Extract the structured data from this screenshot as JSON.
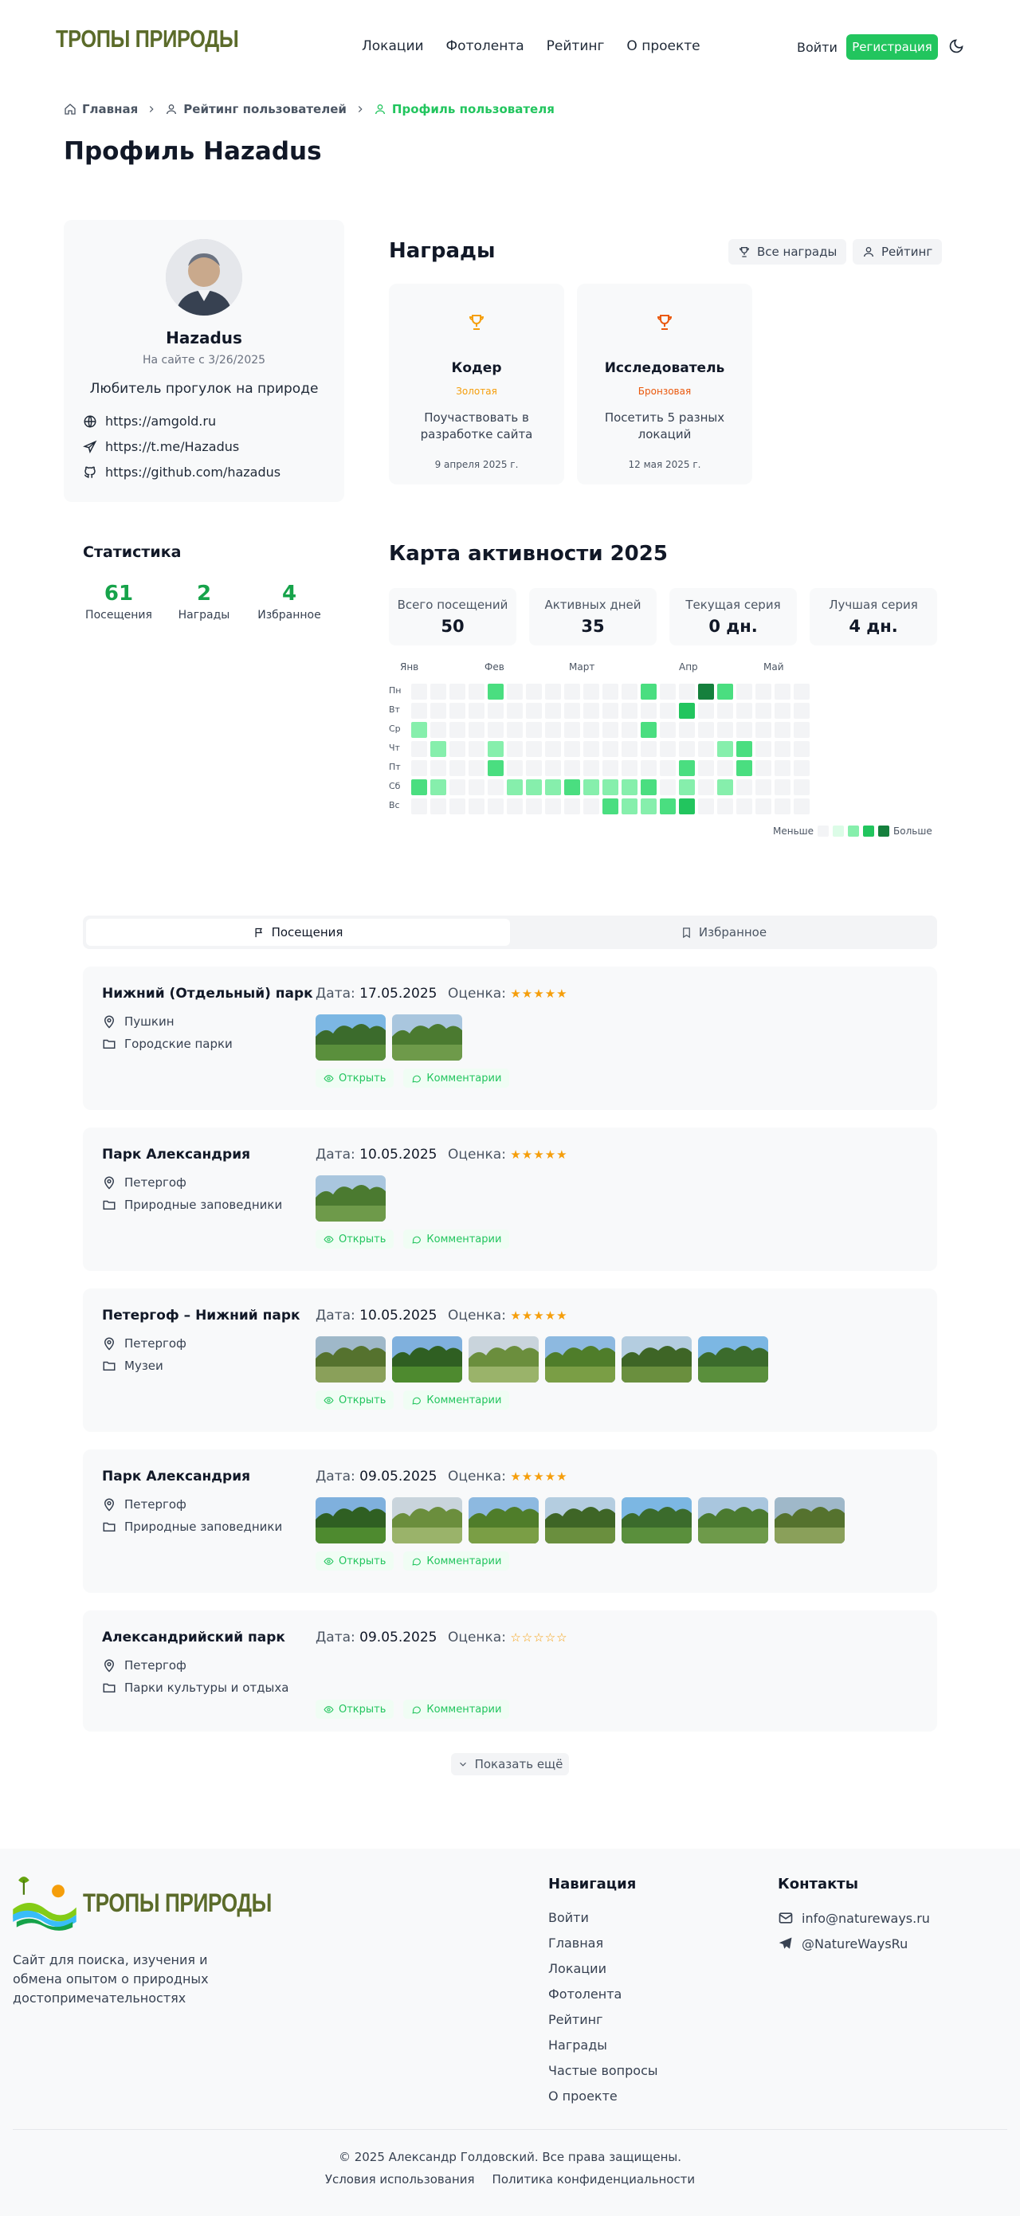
{
  "header": {
    "logo_text": "ТРОПЫ ПРИРОДЫ",
    "nav": [
      "Локации",
      "Фотолента",
      "Рейтинг",
      "О проекте"
    ],
    "login": "Войти",
    "register": "Регистрация"
  },
  "breadcrumbs": [
    "Главная",
    "Рейтинг пользователей",
    "Профиль пользователя"
  ],
  "page_title": "Профиль Hazadus",
  "profile": {
    "name": "Hazadus",
    "since": "На сайте с 3/26/2025",
    "bio": "Любитель прогулок на природе",
    "links": [
      "https://amgold.ru",
      "https://t.me/Hazadus",
      "https://github.com/hazadus"
    ]
  },
  "stats": {
    "title": "Статистика",
    "items": [
      {
        "value": "61",
        "label": "Посещения"
      },
      {
        "value": "2",
        "label": "Награды"
      },
      {
        "value": "4",
        "label": "Избранное"
      }
    ]
  },
  "awards": {
    "title": "Награды",
    "all_button": "Все награды",
    "rating_button": "Рейтинг",
    "items": [
      {
        "name": "Кодер",
        "tier": "Золотая",
        "tier_color": "#f59e0b",
        "desc": "Поучаствовать в разработке сайта",
        "date": "9 апреля 2025 г."
      },
      {
        "name": "Исследователь",
        "tier": "Бронзовая",
        "tier_color": "#ea580c",
        "desc": "Посетить 5 разных локаций",
        "date": "12 мая 2025 г."
      }
    ]
  },
  "activity": {
    "title": "Карта активности 2025",
    "summary": [
      {
        "label": "Всего посещений",
        "value": "50"
      },
      {
        "label": "Активных дней",
        "value": "35"
      },
      {
        "label": "Текущая серия",
        "value": "0 дн."
      },
      {
        "label": "Лучшая серия",
        "value": "4 дн."
      }
    ],
    "months": [
      "Янв",
      "Фев",
      "Март",
      "Апр",
      "Май"
    ],
    "days": [
      "Пн",
      "Вт",
      "Ср",
      "Чт",
      "Пт",
      "Сб",
      "Вс"
    ],
    "grid": [
      "0000300000003005300",
      "0000000000000040000",
      "2000000000003000000",
      "0200200000000000230",
      "0000300000000030030",
      "3200022232223020200",
      "0000000000322340000"
    ],
    "legend_less": "Меньше",
    "legend_more": "Больше",
    "colors": [
      "#f3f4f6",
      "#dcfce7",
      "#86efac",
      "#4ade80",
      "#22c55e",
      "#15803d"
    ]
  },
  "tabs": {
    "visits": "Посещения",
    "favorites": "Избранное"
  },
  "visit_labels": {
    "date": "Дата:",
    "rating": "Оценка:",
    "open": "Открыть",
    "comments": "Комментарии"
  },
  "visits": [
    {
      "name": "Нижний (Отдельный) парк",
      "city": "Пушкин",
      "category": "Городские парки",
      "date": "17.05.2025",
      "stars": "★★★★★",
      "photos": 2
    },
    {
      "name": "Парк Александрия",
      "city": "Петергоф",
      "category": "Природные заповедники",
      "date": "10.05.2025",
      "stars": "★★★★★",
      "photos": 1
    },
    {
      "name": "Петергоф – Нижний парк",
      "city": "Петергоф",
      "category": "Музеи",
      "date": "10.05.2025",
      "stars": "★★★★★",
      "photos": 6
    },
    {
      "name": "Парк Александрия",
      "city": "Петергоф",
      "category": "Природные заповедники",
      "date": "09.05.2025",
      "stars": "★★★★★",
      "photos": 7
    },
    {
      "name": "Александрийский парк",
      "city": "Петергоф",
      "category": "Парки культуры и отдыха",
      "date": "09.05.2025",
      "stars": "☆☆☆☆☆",
      "photos": 0
    }
  ],
  "show_more": "Показать ещё",
  "footer": {
    "logo_text": "ТРОПЫ ПРИРОДЫ",
    "description": "Сайт для поиска, изучения и обмена опытом о природных достопримечательностях",
    "nav_title": "Навигация",
    "nav": [
      "Войти",
      "Главная",
      "Локации",
      "Фотолента",
      "Рейтинг",
      "Награды",
      "Частые вопросы",
      "О проекте"
    ],
    "contacts_title": "Контакты",
    "email": "info@natureways.ru",
    "telegram": "@NatureWaysRu",
    "copyright": "© 2025 Александр Голдовский. Все права защищены.",
    "terms": "Условия использования",
    "privacy": "Политика конфиденциальности"
  }
}
